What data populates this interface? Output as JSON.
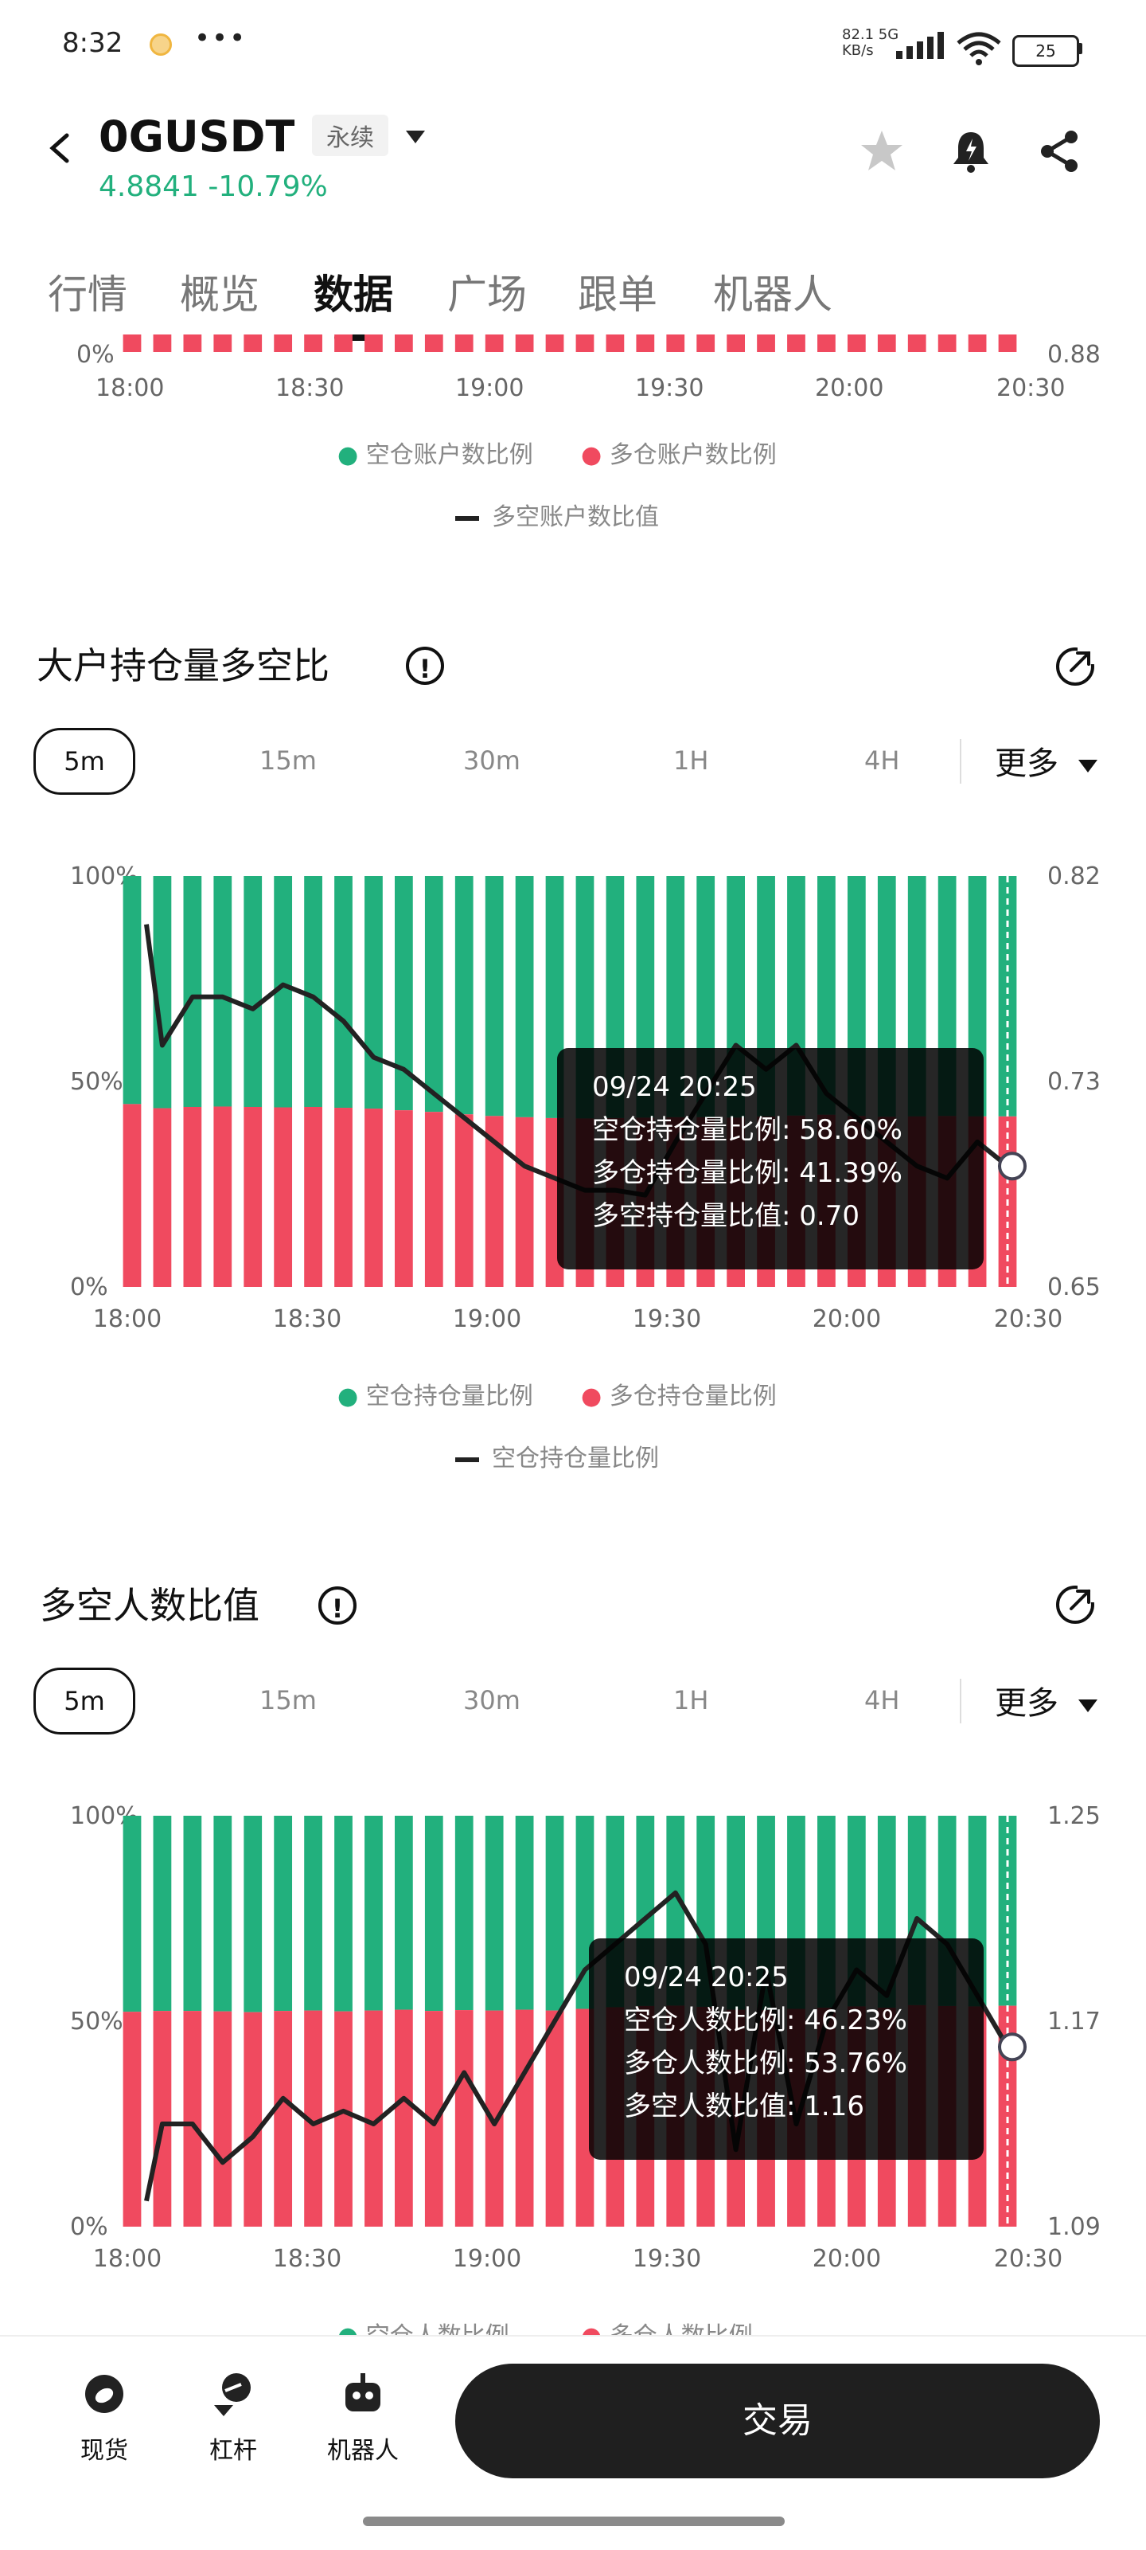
{
  "status_bar": {
    "time": "8:32",
    "dots": "•••",
    "speed_top": "82.1 5G",
    "speed_bottom": "KB/s",
    "battery": "25"
  },
  "header": {
    "symbol": "0GUSDT",
    "contract_type": "永续",
    "price": "4.8841",
    "change": "-10.79%",
    "icons": [
      "back-icon",
      "star-icon",
      "bell-icon",
      "share-icon"
    ]
  },
  "tabs": [
    "行情",
    "概览",
    "数据",
    "广场",
    "跟单",
    "机器人"
  ],
  "active_tab": "数据",
  "top_partial": {
    "xticks": [
      "18:00",
      "18:30",
      "19:00",
      "19:30",
      "20:00",
      "20:30"
    ],
    "y_left_bottom": "0%",
    "y_right_bottom": "0.88",
    "legend": [
      "空仓账户数比例",
      "多仓账户数比例"
    ],
    "line_legend": "多空账户数比值"
  },
  "section1": {
    "title": "大户持仓量多空比",
    "timeframes": [
      "5m",
      "15m",
      "30m",
      "1H",
      "4H"
    ],
    "more": "更多",
    "legend": [
      "空仓持仓量比例",
      "多仓持仓量比例"
    ],
    "line_legend": "空仓持仓量比例",
    "tooltip": {
      "time": "09/24 20:25",
      "rows": [
        "空仓持仓量比例: 58.60%",
        "多仓持仓量比例: 41.39%",
        "多空持仓量比值: 0.70"
      ]
    }
  },
  "section2": {
    "title": "多空人数比值",
    "timeframes": [
      "5m",
      "15m",
      "30m",
      "1H",
      "4H"
    ],
    "more": "更多",
    "legend": [
      "空仓人数比例",
      "多仓人数比例"
    ],
    "tooltip": {
      "time": "09/24 20:25",
      "rows": [
        "空仓人数比例: 46.23%",
        "多仓人数比例: 53.76%",
        "多空人数比值: 1.16"
      ]
    }
  },
  "colors": {
    "green": "#22b07d",
    "red": "#f04a5f",
    "line": "#222222"
  },
  "bottom_nav": [
    "现货",
    "杠杆",
    "机器人"
  ],
  "trade_button": "交易",
  "chart_data": [
    {
      "type": "bar",
      "title": "大户持仓量多空比",
      "categories": [
        "18:00",
        "18:30",
        "19:00",
        "19:30",
        "20:00",
        "20:30"
      ],
      "x_ticks": [
        "18:00",
        "18:30",
        "19:00",
        "19:30",
        "20:00",
        "20:30"
      ],
      "y_left_ticks": [
        "100%",
        "50%",
        "0%"
      ],
      "y_right_ticks": [
        "0.82",
        "0.73",
        "0.65"
      ],
      "ylim_left": [
        0,
        100
      ],
      "ylim_right": [
        0.65,
        0.82
      ],
      "series": [
        {
          "name": "多仓持仓量比例",
          "values": [
            44.5,
            43.5,
            43.8,
            43.9,
            43.8,
            43.7,
            43.8,
            43.6,
            43.4,
            43.0,
            42.6,
            42.0,
            41.6,
            41.3,
            41.1,
            41.0,
            41.1,
            41.2,
            41.3,
            41.3,
            41.2,
            41.5,
            41.7,
            41.9,
            41.6,
            41.4,
            41.5,
            41.6,
            41.5,
            41.5
          ]
        },
        {
          "name": "空仓持仓量比例",
          "values": [
            55.5,
            56.5,
            56.2,
            56.1,
            56.2,
            56.3,
            56.2,
            56.4,
            56.6,
            57.0,
            57.4,
            58.0,
            58.4,
            58.7,
            58.9,
            59.0,
            58.9,
            58.8,
            58.7,
            58.7,
            58.8,
            58.5,
            58.3,
            58.1,
            58.4,
            58.6,
            58.5,
            58.4,
            58.5,
            58.6
          ]
        },
        {
          "name": "多空持仓量比值",
          "values": [
            0.8,
            0.75,
            0.77,
            0.77,
            0.765,
            0.775,
            0.77,
            0.76,
            0.745,
            0.74,
            0.73,
            0.72,
            0.71,
            0.7,
            0.695,
            0.69,
            0.69,
            0.688,
            0.71,
            0.73,
            0.75,
            0.74,
            0.75,
            0.73,
            0.72,
            0.71,
            0.7,
            0.695,
            0.71,
            0.7
          ]
        }
      ]
    },
    {
      "type": "bar",
      "title": "多空人数比值",
      "categories": [
        "18:00",
        "18:30",
        "19:00",
        "19:30",
        "20:00",
        "20:30"
      ],
      "x_ticks": [
        "18:00",
        "18:30",
        "19:00",
        "19:30",
        "20:00",
        "20:30"
      ],
      "y_left_ticks": [
        "100%",
        "50%",
        "0%"
      ],
      "y_right_ticks": [
        "1.25",
        "1.17",
        "1.09"
      ],
      "ylim_left": [
        0,
        100
      ],
      "ylim_right": [
        1.09,
        1.25
      ],
      "series": [
        {
          "name": "多仓人数比例",
          "values": [
            52.3,
            52.5,
            52.5,
            52.4,
            52.2,
            52.5,
            52.6,
            52.4,
            52.6,
            52.8,
            52.5,
            52.7,
            52.6,
            52.8,
            52.6,
            53.0,
            53.4,
            53.7,
            53.8,
            53.5,
            52.8,
            52.7,
            53.0,
            53.3,
            53.6,
            53.3,
            53.9,
            53.7,
            53.6,
            53.76
          ]
        },
        {
          "name": "空仓人数比例",
          "values": [
            47.7,
            47.5,
            47.5,
            47.6,
            47.8,
            47.5,
            47.4,
            47.6,
            47.4,
            47.2,
            47.5,
            47.3,
            47.4,
            47.2,
            47.4,
            47.0,
            46.6,
            46.3,
            46.2,
            46.5,
            47.2,
            47.3,
            47.0,
            46.7,
            46.4,
            46.7,
            46.1,
            46.3,
            46.4,
            46.23
          ]
        },
        {
          "name": "多空人数比值",
          "values": [
            1.1,
            1.13,
            1.13,
            1.115,
            1.125,
            1.14,
            1.13,
            1.135,
            1.13,
            1.14,
            1.13,
            1.15,
            1.13,
            1.15,
            1.17,
            1.19,
            1.2,
            1.21,
            1.22,
            1.2,
            1.12,
            1.19,
            1.13,
            1.17,
            1.19,
            1.18,
            1.21,
            1.2,
            1.18,
            1.16
          ]
        }
      ]
    }
  ]
}
